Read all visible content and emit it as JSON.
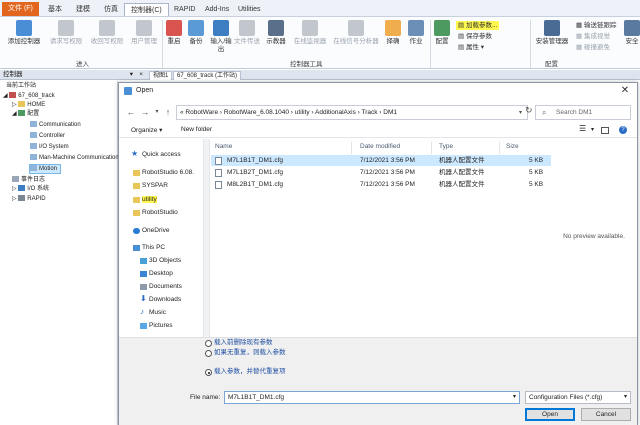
{
  "ribbon_tabs": [
    {
      "label": "文件 (F)"
    },
    {
      "label": "基本"
    },
    {
      "label": "建模"
    },
    {
      "label": "仿真"
    },
    {
      "label": "控制器(C)"
    },
    {
      "label": "RAPID"
    },
    {
      "label": "Add-Ins"
    },
    {
      "label": "Utilities"
    }
  ],
  "ribbon": {
    "buttons": [
      {
        "label": "添加控制器"
      },
      {
        "label": "请求写权限"
      },
      {
        "label": "收回写权限"
      },
      {
        "label": "用户管理"
      },
      {
        "label": "重启"
      },
      {
        "label": "备份"
      },
      {
        "label": "输入/输出"
      },
      {
        "label": "文件传送"
      },
      {
        "label": "示教器"
      },
      {
        "label": "在线监视器"
      },
      {
        "label": "在线信号分析器"
      },
      {
        "label": "择确"
      },
      {
        "label": "作业"
      },
      {
        "label": "配置"
      },
      {
        "label": "安装管理器"
      },
      {
        "label": "安全"
      }
    ],
    "small_buttons": [
      {
        "label": "加载参数..."
      },
      {
        "label": "保存参数"
      },
      {
        "label": "属性"
      },
      {
        "label": "输送链跟踪"
      },
      {
        "label": "集成视觉"
      },
      {
        "label": "碰撞避免"
      }
    ],
    "groups": [
      {
        "label": "进入"
      },
      {
        "label": "控制器工具"
      },
      {
        "label": "配置"
      }
    ]
  },
  "left_panel": {
    "title": "控制器",
    "tree": [
      {
        "label": "当前工作站"
      },
      {
        "label": "67_608_track"
      },
      {
        "label": "HOME"
      },
      {
        "label": "配置"
      },
      {
        "label": "Communication"
      },
      {
        "label": "Controller"
      },
      {
        "label": "I/O System"
      },
      {
        "label": "Man-Machine Communication"
      },
      {
        "label": "Motion"
      },
      {
        "label": "事件日志"
      },
      {
        "label": "I/O 系统"
      },
      {
        "label": "RAPID"
      }
    ]
  },
  "doc_tabs": [
    {
      "label": "视图1"
    },
    {
      "label": "67_608_track (工作站)"
    }
  ],
  "dialog": {
    "title": "Open",
    "address": "« RobotWare › RobotWare_6.08.1040 › utility › AdditionalAxis › Track › DM1",
    "search_placeholder": "Search DM1",
    "organize": "Organize ▾",
    "new_folder": "New folder",
    "nav": [
      {
        "label": "Quick access"
      },
      {
        "label": "RobotStudio 6.08."
      },
      {
        "label": "SYSPAR"
      },
      {
        "label": "utility"
      },
      {
        "label": "RobotStudio"
      },
      {
        "label": "OneDrive"
      },
      {
        "label": "This PC"
      },
      {
        "label": "3D Objects"
      },
      {
        "label": "Desktop"
      },
      {
        "label": "Documents"
      },
      {
        "label": "Downloads"
      },
      {
        "label": "Music"
      },
      {
        "label": "Pictures"
      }
    ],
    "columns": {
      "name": "Name",
      "date": "Date modified",
      "type": "Type",
      "size": "Size"
    },
    "files": [
      {
        "name": "M7L1B1T_DM1.cfg",
        "date": "7/12/2021 3:56 PM",
        "type": "机器人配置文件",
        "size": "5 KB"
      },
      {
        "name": "M7L1B2T_DM1.cfg",
        "date": "7/12/2021 3:56 PM",
        "type": "机器人配置文件",
        "size": "5 KB"
      },
      {
        "name": "M8L2B1T_DM1.cfg",
        "date": "7/12/2021 3:56 PM",
        "type": "机器人配置文件",
        "size": "5 KB"
      }
    ],
    "preview": "No preview available.",
    "options": [
      {
        "label": "载入前删除现有参数"
      },
      {
        "label": "如果无重复，则载入参数"
      },
      {
        "label": "载入参数，并替代重复项"
      }
    ],
    "filename_label": "File name:",
    "filename_value": "M7L1B1T_DM1.cfg",
    "filetype": "Configuration Files (*.cfg)",
    "open": "Open",
    "cancel": "Cancel"
  },
  "colors": {
    "file_tab": "#e2661d",
    "highlight": "#fff94d",
    "selected_row": "#cce8ff",
    "link_blue": "#1f4fa3"
  }
}
